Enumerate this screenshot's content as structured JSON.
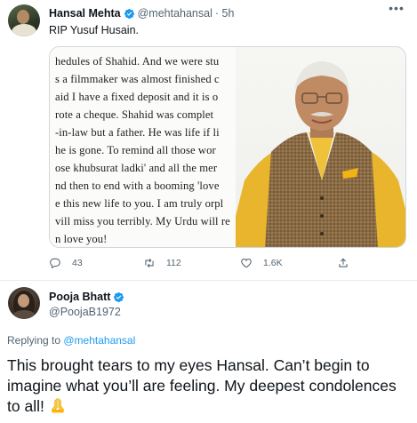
{
  "tweet1": {
    "author_name": "Hansal Mehta",
    "handle": "@mehtahansal",
    "time": "· 5h",
    "text": "RIP Yusuf Husain.",
    "letter_lines": [
      "hedules of Shahid. And we were stu",
      "s a filmmaker was almost finished c",
      "aid I have a fixed deposit and it is o",
      "rote a cheque. Shahid was complet",
      "-in-law but a father. He was life if li",
      "he is gone. To remind all those wor",
      "ose khubsurat ladki' and all the mer",
      "nd then to end with a booming 'love",
      "e this new life to you. I am truly orpl",
      "vill miss you terribly. My Urdu will re",
      "n love you!"
    ],
    "stats": {
      "replies": "43",
      "retweets": "112",
      "likes": "1.6K"
    },
    "icons": {
      "reply": "reply-icon",
      "retweet": "retweet-icon",
      "like": "heart-icon",
      "share": "share-icon",
      "more": "more-icon"
    }
  },
  "tweet2": {
    "author_name": "Pooja Bhatt",
    "handle": "@PoojaB1972",
    "replying_prefix": "Replying to ",
    "replying_to": "@mehtahansal",
    "text": "This brought tears to my eyes Hansal. Can’t begin to imagine what you’ll are feeling. My deepest condolences to all!"
  },
  "colors": {
    "accent": "#1d9bf0",
    "text": "#0f1419",
    "secondary": "#536471",
    "border": "#cfd9de"
  }
}
